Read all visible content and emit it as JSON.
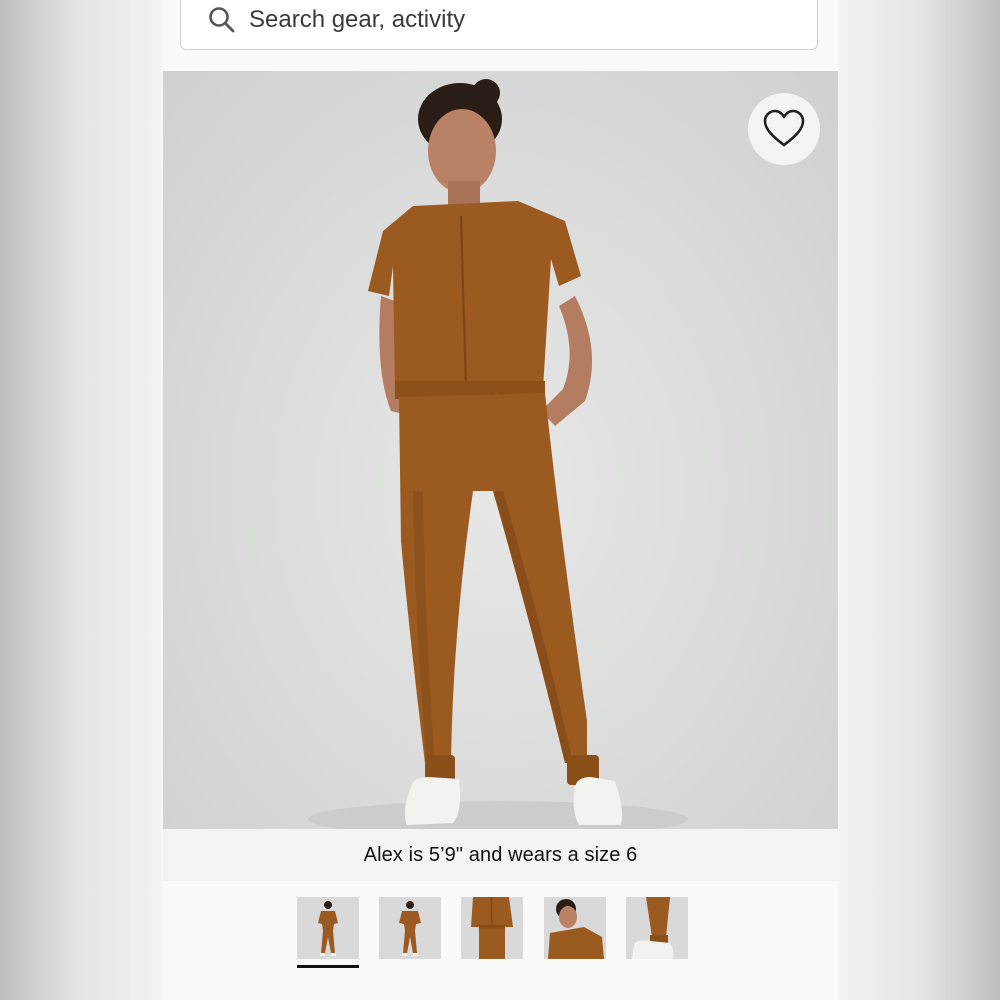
{
  "search": {
    "placeholder": "Search gear, activity",
    "icon": "search-icon"
  },
  "product": {
    "image_alt": "Woman wearing a brown short-sleeve zip-front jumpsuit with drawstring waist and jogger cuffs, white sneakers",
    "favorite_icon": "heart-outline-icon",
    "caption": "Alex is 5’9\" and wears a size 6"
  },
  "thumbnails": {
    "items": [
      {
        "view": "front-full"
      },
      {
        "view": "back-full"
      },
      {
        "view": "side-detail"
      },
      {
        "view": "upper-closeup"
      },
      {
        "view": "leg-detail"
      }
    ],
    "active_index": 0
  },
  "colors": {
    "garment": "#9a5a20",
    "garment_shadow": "#7a4414",
    "background": "#dadbda",
    "active_indicator": "#111111"
  }
}
